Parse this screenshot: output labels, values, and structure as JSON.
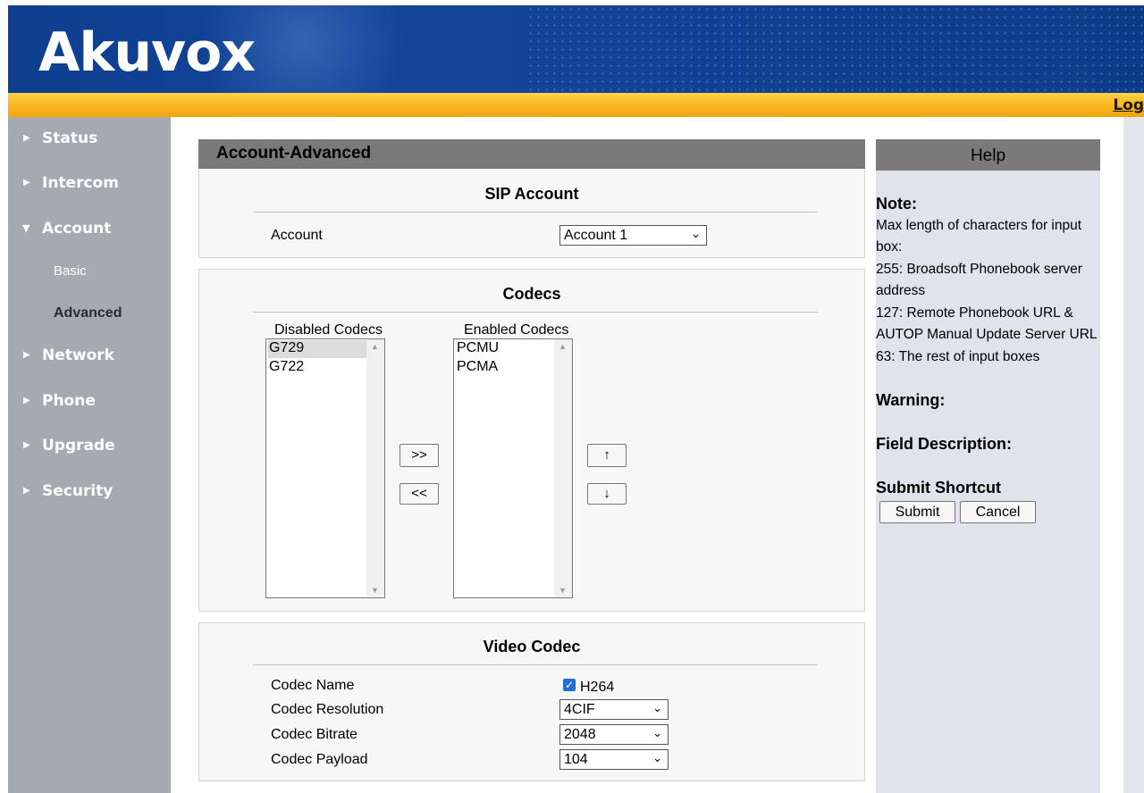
{
  "header": {
    "logo": "Akuvox",
    "logout_label": "Log"
  },
  "sidebar": {
    "items": [
      {
        "label": "Status",
        "expanded": false
      },
      {
        "label": "Intercom",
        "expanded": false
      },
      {
        "label": "Account",
        "expanded": true
      },
      {
        "label": "Network",
        "expanded": false
      },
      {
        "label": "Phone",
        "expanded": false
      },
      {
        "label": "Upgrade",
        "expanded": false
      },
      {
        "label": "Security",
        "expanded": false
      }
    ],
    "account_sub": [
      {
        "label": "Basic",
        "active": false
      },
      {
        "label": "Advanced",
        "active": true
      }
    ]
  },
  "main": {
    "panel_title": "Account-Advanced",
    "sip": {
      "title": "SIP Account",
      "account_label": "Account",
      "account_value": "Account 1"
    },
    "codecs": {
      "title": "Codecs",
      "disabled_label": "Disabled Codecs",
      "enabled_label": "Enabled Codecs",
      "disabled": [
        "G729",
        "G722"
      ],
      "enabled": [
        "PCMU",
        "PCMA"
      ],
      "move_right": ">>",
      "move_left": "<<",
      "move_up": "↑",
      "move_down": "↓"
    },
    "video": {
      "title": "Video Codec",
      "codec_name_label": "Codec Name",
      "codec_name_value": "H264",
      "codec_name_checked": true,
      "resolution_label": "Codec Resolution",
      "resolution_value": "4CIF",
      "bitrate_label": "Codec Bitrate",
      "bitrate_value": "2048",
      "payload_label": "Codec Payload",
      "payload_value": "104"
    }
  },
  "help": {
    "title": "Help",
    "note_heading": "Note:",
    "note_lines": [
      "Max length of characters for input",
      "box:",
      "255: Broadsoft Phonebook server",
      "address",
      "127: Remote Phonebook URL &",
      "AUTOP Manual Update Server URL",
      "63: The rest of input boxes"
    ],
    "warning_heading": "Warning:",
    "field_desc_heading": "Field Description:",
    "shortcut_heading": "Submit Shortcut",
    "submit_label": "Submit",
    "cancel_label": "Cancel"
  },
  "colors": {
    "header_blue": "#12449a",
    "orange_bar": "#f7b21a",
    "sidebar_grey": "#a6aab0",
    "panel_head_grey": "#7a7a7a",
    "help_bg": "#dfe4ec",
    "checkbox_blue": "#1f6fd6"
  }
}
